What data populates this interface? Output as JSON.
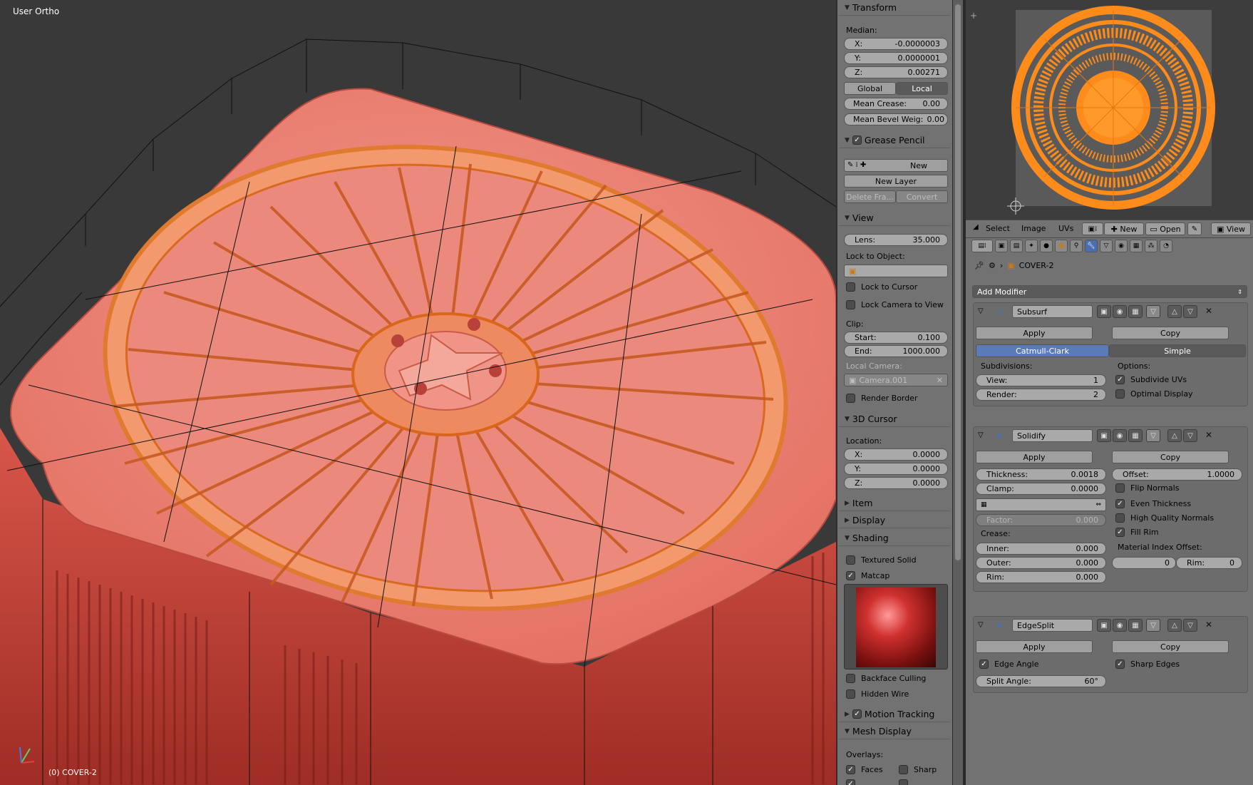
{
  "viewport": {
    "view_label": "User Ortho",
    "object_label": "(0) COVER-2"
  },
  "npanel": {
    "transform": {
      "title": "Transform",
      "median_label": "Median:",
      "x_label": "X:",
      "x": "-0.0000003",
      "y_label": "Y:",
      "y": "0.0000001",
      "z_label": "Z:",
      "z": "0.00271",
      "global_label": "Global",
      "local_label": "Local",
      "crease_label": "Mean Crease:",
      "crease": "0.00",
      "bevel_label": "Mean Bevel Weig:",
      "bevel": "0.00"
    },
    "grease": {
      "title": "Grease Pencil",
      "new_label": "New",
      "new_layer_label": "New Layer",
      "delete_label": "Delete Fra...",
      "convert_label": "Convert"
    },
    "view": {
      "title": "View",
      "lens_label": "Lens:",
      "lens": "35.000",
      "lock_obj_label": "Lock to Object:",
      "lock_cursor_label": "Lock to Cursor",
      "lock_camera_label": "Lock Camera to View",
      "clip_label": "Clip:",
      "start_label": "Start:",
      "start": "0.100",
      "end_label": "End:",
      "end": "1000.000",
      "local_cam_label": "Local Camera:",
      "camera": "Camera.001",
      "render_border_label": "Render Border"
    },
    "cursor": {
      "title": "3D Cursor",
      "location_label": "Location:",
      "x_label": "X:",
      "x": "0.0000",
      "y_label": "Y:",
      "y": "0.0000",
      "z_label": "Z:",
      "z": "0.0000"
    },
    "item": {
      "title": "Item"
    },
    "display": {
      "title": "Display"
    },
    "shading": {
      "title": "Shading",
      "textured_label": "Textured Solid",
      "matcap_label": "Matcap",
      "backface_label": "Backface Culling",
      "hidden_wire_label": "Hidden Wire"
    },
    "motion": {
      "title": "Motion Tracking"
    },
    "mesh_display": {
      "title": "Mesh Display",
      "overlays_label": "Overlays:",
      "faces_label": "Faces",
      "sharp_label": "Sharp"
    }
  },
  "uv_header": {
    "select_label": "Select",
    "image_label": "Image",
    "uvs_label": "UVs",
    "new_label": "New",
    "open_label": "Open",
    "view_label": "View"
  },
  "props": {
    "object_name": "COVER-2",
    "add_modifier_label": "Add Modifier",
    "subsurf": {
      "name": "Subsurf",
      "apply_label": "Apply",
      "copy_label": "Copy",
      "catmull_label": "Catmull-Clark",
      "simple_label": "Simple",
      "subdivisions_label": "Subdivisions:",
      "view_label": "View:",
      "view": "1",
      "render_label": "Render:",
      "render": "2",
      "options_label": "Options:",
      "subdivide_uvs_label": "Subdivide UVs",
      "optimal_label": "Optimal Display"
    },
    "solidify": {
      "name": "Solidify",
      "apply_label": "Apply",
      "copy_label": "Copy",
      "thickness_label": "Thickness:",
      "thickness": "0.0018",
      "offset_label": "Offset:",
      "offset": "1.0000",
      "clamp_label": "Clamp:",
      "clamp": "0.0000",
      "flip_label": "Flip Normals",
      "even_label": "Even Thickness",
      "hq_label": "High Quality Normals",
      "fill_label": "Fill Rim",
      "factor_label": "Factor:",
      "factor": "0.000",
      "crease_label": "Crease:",
      "inner_label": "Inner:",
      "inner": "0.000",
      "outer_label": "Outer:",
      "outer": "0.000",
      "rim_label": "Rim:",
      "rim": "0.000",
      "mat_offset_label": "Material Index Offset:",
      "mat_offset": "0",
      "mat_rim_label": "Rim:",
      "mat_rim": "0"
    },
    "edgesplit": {
      "name": "EdgeSplit",
      "apply_label": "Apply",
      "copy_label": "Copy",
      "edge_angle_label": "Edge Angle",
      "sharp_edges_label": "Sharp Edges",
      "split_angle_label": "Split Angle:",
      "split_angle": "60°"
    }
  },
  "colors": {
    "accent": "#5a7ab8",
    "model": "#e87565",
    "uv_orange": "#ff8c1a"
  }
}
